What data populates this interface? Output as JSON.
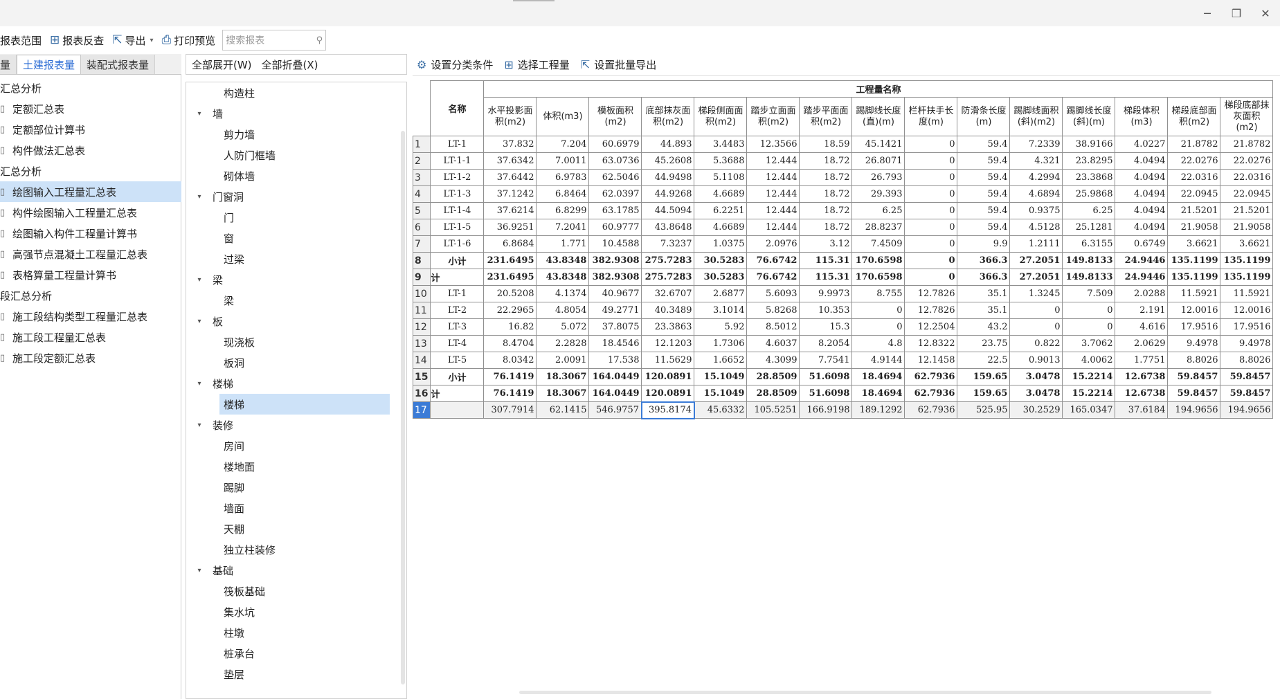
{
  "toolbar": {
    "items": [
      {
        "label": "报表范围",
        "icon": "scope-icon"
      },
      {
        "label": "报表反查",
        "icon": "table-lookup-icon"
      },
      {
        "label": "导出",
        "icon": "export-icon"
      },
      {
        "label": "打印预览",
        "icon": "print-preview-icon"
      }
    ],
    "search_placeholder": "搜索报表"
  },
  "left_tabs": [
    "量",
    "土建报表量",
    "装配式报表量"
  ],
  "left_tree": [
    {
      "label": "汇总分析",
      "type": "group"
    },
    {
      "label": "定额汇总表",
      "type": "leaf"
    },
    {
      "label": "定额部位计算书",
      "type": "leaf"
    },
    {
      "label": "构件做法汇总表",
      "type": "leaf"
    },
    {
      "label": "汇总分析",
      "type": "group"
    },
    {
      "label": "绘图输入工程量汇总表",
      "type": "leaf",
      "selected": true
    },
    {
      "label": "构件绘图输入工程量汇总表",
      "type": "leaf"
    },
    {
      "label": "绘图输入构件工程量计算书",
      "type": "leaf"
    },
    {
      "label": "高强节点混凝土工程量汇总表",
      "type": "leaf"
    },
    {
      "label": "表格算量工程量计算书",
      "type": "leaf"
    },
    {
      "label": "段汇总分析",
      "type": "group"
    },
    {
      "label": "施工段结构类型工程量汇总表",
      "type": "leaf"
    },
    {
      "label": "施工段工程量汇总表",
      "type": "leaf"
    },
    {
      "label": "施工段定额汇总表",
      "type": "leaf"
    }
  ],
  "middle": {
    "expand_all": "全部展开(W)",
    "collapse_all": "全部折叠(X)",
    "tree": [
      {
        "label": "构造柱",
        "type": "child"
      },
      {
        "label": "墙",
        "type": "group"
      },
      {
        "label": "剪力墙",
        "type": "child"
      },
      {
        "label": "人防门框墙",
        "type": "child"
      },
      {
        "label": "砌体墙",
        "type": "child"
      },
      {
        "label": "门窗洞",
        "type": "group"
      },
      {
        "label": "门",
        "type": "child"
      },
      {
        "label": "窗",
        "type": "child"
      },
      {
        "label": "过梁",
        "type": "child"
      },
      {
        "label": "梁",
        "type": "group"
      },
      {
        "label": "梁",
        "type": "child"
      },
      {
        "label": "板",
        "type": "group"
      },
      {
        "label": "现浇板",
        "type": "child"
      },
      {
        "label": "板洞",
        "type": "child"
      },
      {
        "label": "楼梯",
        "type": "group"
      },
      {
        "label": "楼梯",
        "type": "child",
        "selected": true
      },
      {
        "label": "装修",
        "type": "group"
      },
      {
        "label": "房间",
        "type": "child"
      },
      {
        "label": "楼地面",
        "type": "child"
      },
      {
        "label": "踢脚",
        "type": "child"
      },
      {
        "label": "墙面",
        "type": "child"
      },
      {
        "label": "天棚",
        "type": "child"
      },
      {
        "label": "独立柱装修",
        "type": "child"
      },
      {
        "label": "基础",
        "type": "group"
      },
      {
        "label": "筏板基础",
        "type": "child"
      },
      {
        "label": "集水坑",
        "type": "child"
      },
      {
        "label": "柱墩",
        "type": "child"
      },
      {
        "label": "桩承台",
        "type": "child"
      },
      {
        "label": "垫层",
        "type": "child"
      }
    ]
  },
  "right_toolbar": [
    {
      "label": "设置分类条件",
      "icon": "filter-settings-icon"
    },
    {
      "label": "选择工程量",
      "icon": "table-select-icon"
    },
    {
      "label": "设置批量导出",
      "icon": "batch-export-icon"
    }
  ],
  "grid": {
    "group_header": "工程量名称",
    "name_header": "名称",
    "columns": [
      "水平投影面积(m2)",
      "体积(m3)",
      "模板面积(m2)",
      "底部抹灰面积(m2)",
      "梯段侧面面积(m2)",
      "踏步立面面积(m2)",
      "踏步平面面积(m2)",
      "踢脚线长度(直)(m)",
      "栏杆扶手长度(m)",
      "防滑条长度(m)",
      "踢脚线面积(斜)(m2)",
      "踢脚线长度(斜)(m)",
      "梯段体积(m3)",
      "梯段底部面积(m2)",
      "梯段底部抹灰面积(m2)"
    ],
    "rows": [
      {
        "n": "1",
        "name": "LT-1",
        "v": [
          "37.832",
          "7.204",
          "60.6979",
          "44.893",
          "3.4483",
          "12.3566",
          "18.59",
          "45.1421",
          "0",
          "59.4",
          "7.2339",
          "38.9166",
          "4.0227",
          "21.8782",
          "21.8782"
        ]
      },
      {
        "n": "2",
        "name": "LT-1-1",
        "v": [
          "37.6342",
          "7.0011",
          "63.0736",
          "45.2608",
          "5.3688",
          "12.444",
          "18.72",
          "26.8071",
          "0",
          "59.4",
          "4.321",
          "23.8295",
          "4.0494",
          "22.0276",
          "22.0276"
        ]
      },
      {
        "n": "3",
        "name": "LT-1-2",
        "v": [
          "37.6442",
          "6.9783",
          "62.5046",
          "44.9498",
          "5.1108",
          "12.444",
          "18.72",
          "26.793",
          "0",
          "59.4",
          "4.2994",
          "23.3868",
          "4.0494",
          "22.0316",
          "22.0316"
        ]
      },
      {
        "n": "4",
        "name": "LT-1-3",
        "v": [
          "37.1242",
          "6.8464",
          "62.0397",
          "44.9268",
          "4.6689",
          "12.444",
          "18.72",
          "29.393",
          "0",
          "59.4",
          "4.6894",
          "25.9868",
          "4.0494",
          "22.0945",
          "22.0945"
        ]
      },
      {
        "n": "5",
        "name": "LT-1-4",
        "v": [
          "37.6214",
          "6.8299",
          "63.1785",
          "44.5094",
          "6.2251",
          "12.444",
          "18.72",
          "6.25",
          "0",
          "59.4",
          "0.9375",
          "6.25",
          "4.0494",
          "21.5201",
          "21.5201"
        ]
      },
      {
        "n": "6",
        "name": "LT-1-5",
        "v": [
          "36.9251",
          "7.2041",
          "60.9777",
          "43.8648",
          "4.6689",
          "12.444",
          "18.72",
          "28.8237",
          "0",
          "59.4",
          "4.5128",
          "25.1281",
          "4.0494",
          "21.9058",
          "21.9058"
        ]
      },
      {
        "n": "7",
        "name": "LT-1-6",
        "v": [
          "6.8684",
          "1.771",
          "10.4588",
          "7.3237",
          "1.0375",
          "2.0976",
          "3.12",
          "7.4509",
          "0",
          "9.9",
          "1.2111",
          "6.3155",
          "0.6749",
          "3.6621",
          "3.6621"
        ]
      },
      {
        "n": "8",
        "name": "小计",
        "bold": true,
        "v": [
          "231.6495",
          "43.8348",
          "382.9308",
          "275.7283",
          "30.5283",
          "76.6742",
          "115.31",
          "170.6598",
          "0",
          "366.3",
          "27.2051",
          "149.8133",
          "24.9446",
          "135.1199",
          "135.1199"
        ]
      },
      {
        "n": "9",
        "name": "计",
        "bold": true,
        "left": true,
        "v": [
          "231.6495",
          "43.8348",
          "382.9308",
          "275.7283",
          "30.5283",
          "76.6742",
          "115.31",
          "170.6598",
          "0",
          "366.3",
          "27.2051",
          "149.8133",
          "24.9446",
          "135.1199",
          "135.1199"
        ]
      },
      {
        "n": "10",
        "name": "LT-1",
        "v": [
          "20.5208",
          "4.1374",
          "40.9677",
          "32.6707",
          "2.6877",
          "5.6093",
          "9.9973",
          "8.755",
          "12.7826",
          "35.1",
          "1.3245",
          "7.509",
          "2.0288",
          "11.5921",
          "11.5921"
        ]
      },
      {
        "n": "11",
        "name": "LT-2",
        "v": [
          "22.2965",
          "4.8054",
          "49.2771",
          "40.3489",
          "3.1014",
          "5.8268",
          "10.353",
          "0",
          "12.7826",
          "35.1",
          "0",
          "0",
          "2.191",
          "12.0016",
          "12.0016"
        ]
      },
      {
        "n": "12",
        "name": "LT-3",
        "v": [
          "16.82",
          "5.072",
          "37.8075",
          "23.3863",
          "5.92",
          "8.5012",
          "15.3",
          "0",
          "12.2504",
          "43.2",
          "0",
          "0",
          "4.616",
          "17.9516",
          "17.9516"
        ]
      },
      {
        "n": "13",
        "name": "LT-4",
        "v": [
          "8.4704",
          "2.2828",
          "18.4546",
          "12.1203",
          "1.7306",
          "4.6037",
          "8.2054",
          "4.8",
          "12.8322",
          "23.75",
          "0.822",
          "3.7062",
          "2.0629",
          "9.4978",
          "9.4978"
        ]
      },
      {
        "n": "14",
        "name": "LT-5",
        "v": [
          "8.0342",
          "2.0091",
          "17.538",
          "11.5629",
          "1.6652",
          "4.3099",
          "7.7541",
          "4.9144",
          "12.1458",
          "22.5",
          "0.9013",
          "4.0062",
          "1.7751",
          "8.8026",
          "8.8026"
        ]
      },
      {
        "n": "15",
        "name": "小计",
        "bold": true,
        "v": [
          "76.1419",
          "18.3067",
          "164.0449",
          "120.0891",
          "15.1049",
          "28.8509",
          "51.6098",
          "18.4694",
          "62.7936",
          "159.65",
          "3.0478",
          "15.2214",
          "12.6738",
          "59.8457",
          "59.8457"
        ]
      },
      {
        "n": "16",
        "name": "计",
        "bold": true,
        "left": true,
        "v": [
          "76.1419",
          "18.3067",
          "164.0449",
          "120.0891",
          "15.1049",
          "28.8509",
          "51.6098",
          "18.4694",
          "62.7936",
          "159.65",
          "3.0478",
          "15.2214",
          "12.6738",
          "59.8457",
          "59.8457"
        ]
      },
      {
        "n": "17",
        "name": "",
        "total": true,
        "v": [
          "307.7914",
          "62.1415",
          "546.9757",
          "395.8174",
          "45.6332",
          "105.5251",
          "166.9198",
          "189.1292",
          "62.7936",
          "525.95",
          "30.2529",
          "165.0347",
          "37.6184",
          "194.9656",
          "194.9656"
        ]
      }
    ]
  }
}
